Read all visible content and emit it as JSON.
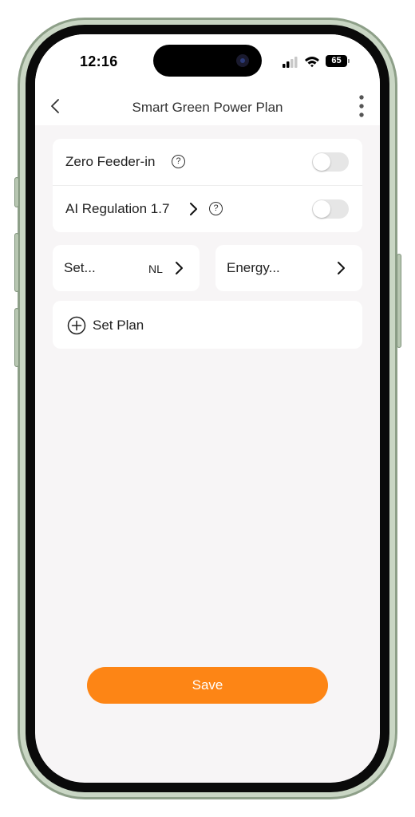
{
  "status_bar": {
    "time": "12:16",
    "battery": "65"
  },
  "header": {
    "title": "Smart Green Power Plan"
  },
  "settings": {
    "zero_feeder": {
      "label": "Zero Feeder-in",
      "help": "?",
      "enabled": false
    },
    "ai_regulation": {
      "label": "AI Regulation 1.7",
      "help": "?",
      "enabled": false
    }
  },
  "tiles": {
    "set": {
      "label": "Set...",
      "value": "NL"
    },
    "energy": {
      "label": "Energy..."
    }
  },
  "plan": {
    "add_label": "Set Plan"
  },
  "actions": {
    "save_label": "Save"
  },
  "colors": {
    "accent": "#fd8515",
    "background": "#f7f5f6"
  },
  "icons": [
    "back-chevron-icon",
    "more-vertical-icon",
    "help-icon",
    "chevron-right-icon",
    "plus-circle-icon",
    "signal-icon",
    "wifi-icon",
    "battery-icon"
  ]
}
